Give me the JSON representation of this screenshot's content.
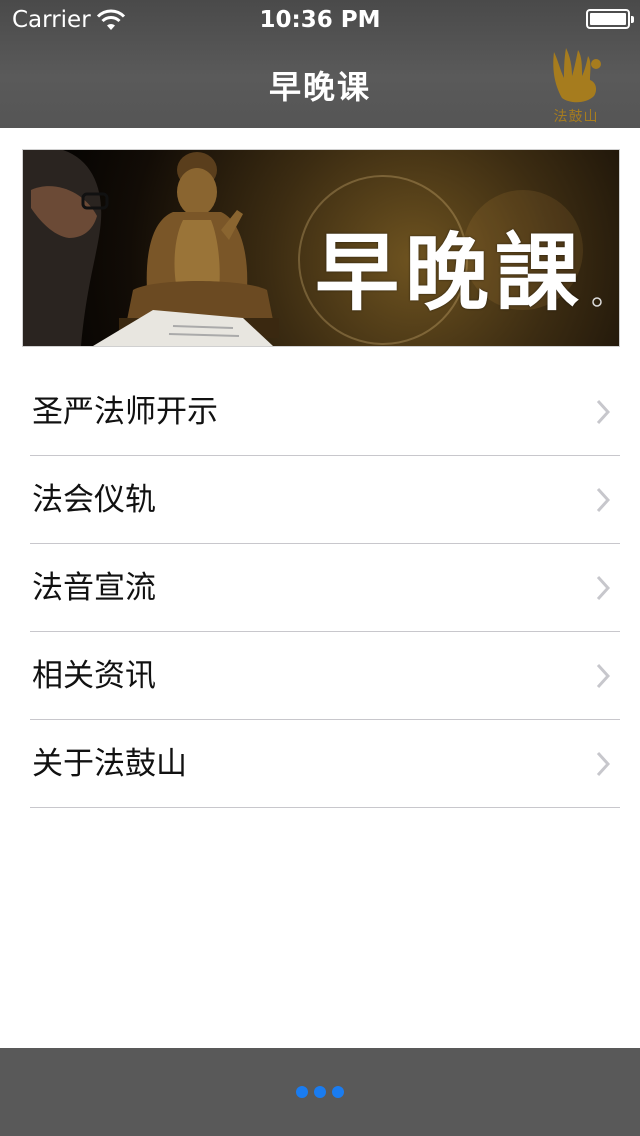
{
  "status_bar": {
    "carrier": "Carrier",
    "time": "10:36 PM"
  },
  "nav": {
    "title": "早晚课",
    "logo_text": "法鼓山"
  },
  "banner": {
    "title": "早晚課"
  },
  "menu": {
    "items": [
      {
        "label": "圣严法师开示"
      },
      {
        "label": "法会仪轨"
      },
      {
        "label": "法音宣流"
      },
      {
        "label": "相关资讯"
      },
      {
        "label": "关于法鼓山"
      }
    ]
  },
  "colors": {
    "nav_bg": "#555555",
    "accent": "#1a7cf0",
    "logo_gold": "#a67c1e"
  }
}
